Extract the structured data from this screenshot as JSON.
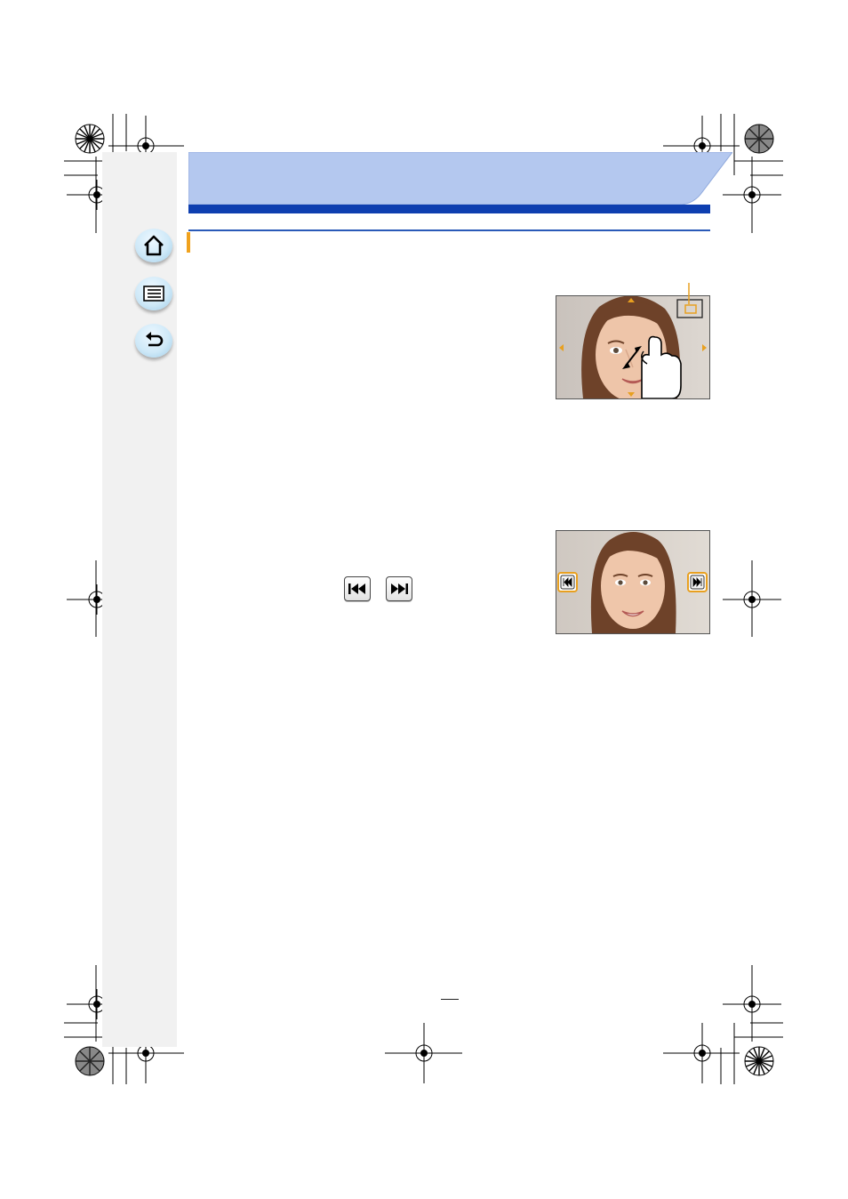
{
  "header": {
    "title": ""
  },
  "nav": {
    "home": "home-icon",
    "menu": "menu-list-icon",
    "back": "return-icon"
  },
  "section": {
    "heading": ""
  },
  "figures": {
    "zoom": {
      "highlight_color": "#f0a21d"
    },
    "skip": {
      "highlight_color": "#f0a21d"
    }
  },
  "inline_icons": {
    "previous": "skip-previous-icon",
    "next": "skip-next-icon"
  },
  "colors": {
    "header_light": "#b4c8ef",
    "header_dark": "#0e3fb0",
    "accent_orange": "#f0a21d",
    "sidebar": "#f1f1f1"
  },
  "footer": {
    "page_number": ""
  }
}
